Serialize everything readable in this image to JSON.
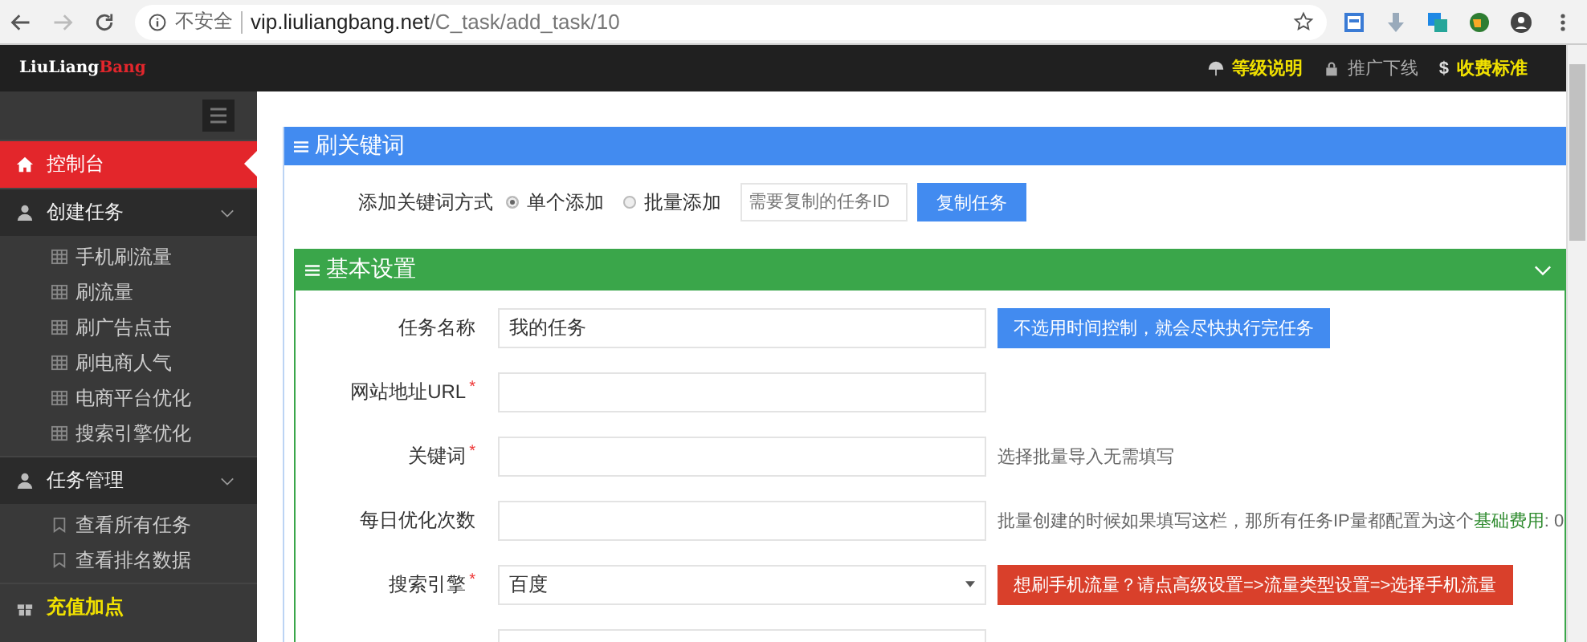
{
  "browser": {
    "security": "不安全",
    "host": "vip.liuliangbang.net",
    "path": "/C_task/add_task/10"
  },
  "logo": {
    "first": "LiuLiang",
    "second": "Bang"
  },
  "top_links": [
    {
      "kind": "umbrella",
      "label": "等级说明",
      "highlight": true
    },
    {
      "kind": "lock",
      "label": "推广下线",
      "highlight": false
    },
    {
      "kind": "dollar",
      "symbol": "$",
      "label": "收费标准",
      "highlight": true
    }
  ],
  "sidebar": {
    "items": [
      {
        "kind": "home",
        "label": "控制台",
        "selected": true,
        "highlight": false
      },
      {
        "kind": "group",
        "label": "创建任务",
        "selected": false,
        "highlight": false,
        "expanded": true,
        "children": [
          {
            "kind": "grid",
            "label": "手机刷流量"
          },
          {
            "kind": "grid",
            "label": "刷流量"
          },
          {
            "kind": "grid",
            "label": "刷广告点击"
          },
          {
            "kind": "grid",
            "label": "刷电商人气"
          },
          {
            "kind": "grid",
            "label": "电商平台优化"
          },
          {
            "kind": "grid",
            "label": "搜索引擎优化"
          }
        ]
      },
      {
        "kind": "group",
        "label": "任务管理",
        "selected": false,
        "highlight": false,
        "expanded": true,
        "children": [
          {
            "kind": "bookmark",
            "label": "查看所有任务"
          },
          {
            "kind": "bookmark",
            "label": "查看排名数据"
          }
        ]
      },
      {
        "kind": "gift",
        "label": "充值加点",
        "selected": false,
        "highlight": true
      }
    ]
  },
  "keyword_panel": {
    "title": "刷关键词",
    "mode_label": "添加关键词方式",
    "modes": [
      {
        "label": "单个添加",
        "selected": true
      },
      {
        "label": "批量添加",
        "selected": false
      }
    ],
    "copy_placeholder": "需要复制的任务ID",
    "copy_button": "复制任务"
  },
  "basic_panel": {
    "title": "基本设置",
    "expanded": true,
    "required_mark": "*",
    "fields": [
      {
        "kind": "text",
        "label": "任务名称",
        "required": false,
        "value": "我的任务",
        "note": {
          "kind": "info",
          "text": "不选用时间控制，就会尽快执行完任务"
        }
      },
      {
        "kind": "text",
        "label": "网站地址URL",
        "required": true
      },
      {
        "kind": "text",
        "label": "关键词",
        "required": true,
        "note": {
          "kind": "hint",
          "text": "选择批量导入无需填写"
        }
      },
      {
        "kind": "text",
        "label": "每日优化次数",
        "required": false,
        "note": {
          "kind": "hint",
          "text": "批量创建的时候如果填写这栏，那所有任务IP量都配置为这个",
          "highlight": "基础费用",
          "after": ": 0"
        }
      },
      {
        "kind": "select",
        "label": "搜索引擎",
        "required": true,
        "value": "百度",
        "note": {
          "kind": "alert",
          "text": "想刷手机流量？请点高级设置=>流量类型设置=>选择手机流量"
        }
      },
      {
        "kind": "text",
        "required": false
      }
    ]
  }
}
